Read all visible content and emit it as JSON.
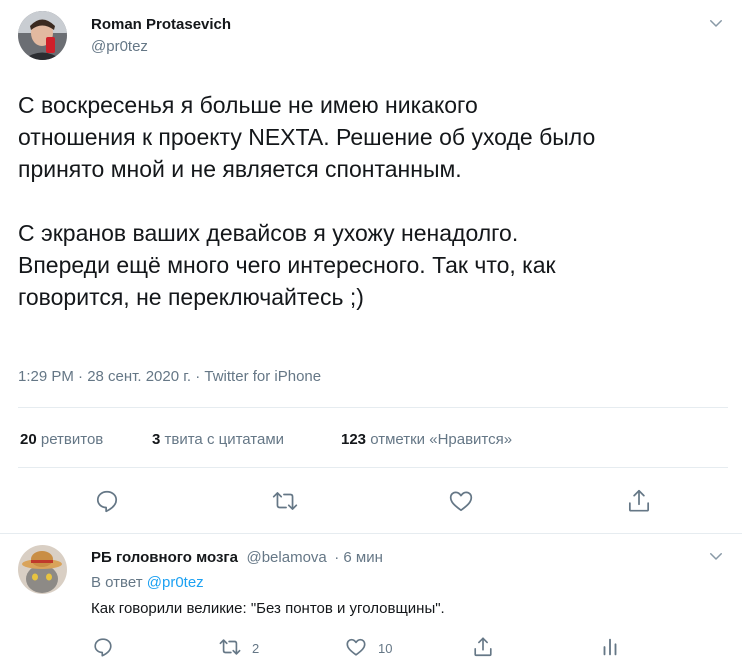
{
  "tweet": {
    "author_name": "Roman Protasevich",
    "author_handle": "@pr0tez",
    "text": "С воскресенья я больше не имею никакого\nотношения к проекту NEXTA. Решение об уходе было\nпринято мной и не является спонтанным.\n\nС экранов ваших девайсов я ухожу ненадолго.\nВпереди ещё много чего интересного. Так что, как\nговорится, не переключайтесь ;)",
    "meta": "1:29 PM · 28 сент. 2020 г. · Twitter for iPhone",
    "retweets_count": "20",
    "retweets_label": "ретвитов",
    "quotes_count": "3",
    "quotes_label": "твита с цитатами",
    "likes_count": "123",
    "likes_label": "отметки «Нравится»"
  },
  "reply": {
    "author_name": "РБ головного мозга",
    "author_handle": "@belamova",
    "time": "· 6 мин",
    "replying_prefix": "В ответ",
    "replying_to": "@pr0tez",
    "text": "Как говорили великие: \"Без понтов и уголовщины\".",
    "retweets": "2",
    "likes": "10"
  },
  "colors": {
    "accent": "#1da1f2",
    "icon": "#657786",
    "divider": "#e6ecf0"
  },
  "icons": [
    "chevron-down-icon",
    "reply-icon",
    "retweet-icon",
    "like-icon",
    "share-icon",
    "analytics-icon"
  ]
}
